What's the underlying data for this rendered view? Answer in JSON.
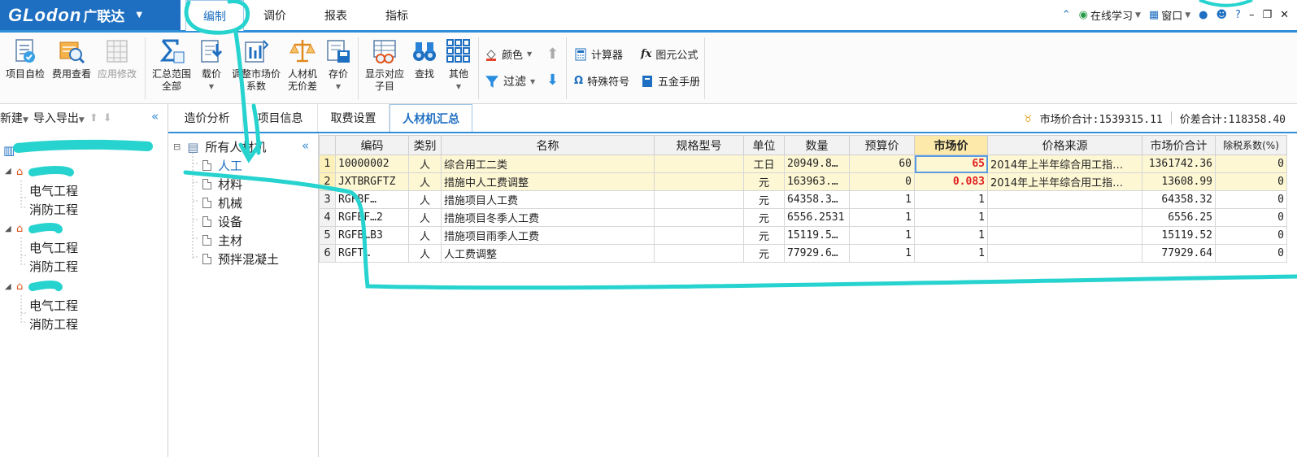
{
  "app": {
    "brand": "GLodon",
    "brand_cn": "广联达",
    "menu_tabs": [
      "编制",
      "调价",
      "报表",
      "指标"
    ],
    "active_menu_tab": "编制",
    "right_tools": {
      "online_learning": "在线学习",
      "window": "窗口",
      "help": "?"
    }
  },
  "ribbon": {
    "buttons": [
      {
        "label1": "项目自检",
        "label2": ""
      },
      {
        "label1": "费用查看",
        "label2": ""
      },
      {
        "label1": "应用修改",
        "label2": ""
      },
      {
        "label1": "汇总范围",
        "label2": "全部"
      },
      {
        "label1": "载价",
        "label2": ""
      },
      {
        "label1": "调整市场价",
        "label2": "系数"
      },
      {
        "label1": "人材机",
        "label2": "无价差"
      },
      {
        "label1": "存价",
        "label2": ""
      },
      {
        "label1": "显示对应",
        "label2": "子目"
      },
      {
        "label1": "查找",
        "label2": ""
      },
      {
        "label1": "其他",
        "label2": ""
      }
    ],
    "small": {
      "color": "颜色",
      "filter": "过滤",
      "calculator": "计算器",
      "formula": "图元公式",
      "special_symbol": "特殊符号",
      "hardware_manual": "五金手册"
    }
  },
  "left_panel": {
    "toolbar": {
      "new": "新建",
      "import_export": "导入导出"
    },
    "items": [
      "电气工程",
      "消防工程",
      "电气工程",
      "消防工程",
      "电气工程",
      "消防工程"
    ]
  },
  "content_tabs": {
    "tabs": [
      "造价分析",
      "项目信息",
      "取费设置",
      "人材机汇总"
    ],
    "active": "人材机汇总",
    "market_total": "市场价合计:1539315.11",
    "diff_total": "价差合计:118358.40"
  },
  "category_tree": {
    "root": "所有人材机",
    "items": [
      "人工",
      "材料",
      "机械",
      "设备",
      "主材",
      "预拌混凝土"
    ],
    "selected": "人工"
  },
  "grid": {
    "columns": [
      "",
      "编码",
      "类别",
      "名称",
      "规格型号",
      "单位",
      "数量",
      "预算价",
      "市场价",
      "价格来源",
      "市场价合计",
      "除税系数(%)"
    ],
    "rows": [
      {
        "n": "1",
        "code": "10000002",
        "type": "人",
        "name": "综合用工二类",
        "spec": "",
        "unit": "工日",
        "qty": "20949.8…",
        "budget": "60",
        "market": "65",
        "source": "2014年上半年综合用工指…",
        "total": "1361742.36",
        "tax": "0"
      },
      {
        "n": "2",
        "code": "JXTBRGFTZ",
        "type": "人",
        "name": "措施中人工费调整",
        "spec": "",
        "unit": "元",
        "qty": "163963.…",
        "budget": "0",
        "market": "0.083",
        "source": "2014年上半年综合用工指…",
        "total": "13608.99",
        "tax": "0"
      },
      {
        "n": "3",
        "code": "RGFBF…",
        "type": "人",
        "name": "措施项目人工费",
        "spec": "",
        "unit": "元",
        "qty": "64358.3…",
        "budget": "1",
        "market": "1",
        "source": "",
        "total": "64358.32",
        "tax": "0"
      },
      {
        "n": "4",
        "code": "RGFBF…2",
        "type": "人",
        "name": "措施项目冬季人工费",
        "spec": "",
        "unit": "元",
        "qty": "6556.2531",
        "budget": "1",
        "market": "1",
        "source": "",
        "total": "6556.25",
        "tax": "0"
      },
      {
        "n": "5",
        "code": "RGFB…B3",
        "type": "人",
        "name": "措施项目雨季人工费",
        "spec": "",
        "unit": "元",
        "qty": "15119.5…",
        "budget": "1",
        "market": "1",
        "source": "",
        "total": "15119.52",
        "tax": "0"
      },
      {
        "n": "6",
        "code": "RGFT…",
        "type": "人",
        "name": "人工费调整",
        "spec": "",
        "unit": "元",
        "qty": "77929.6…",
        "budget": "1",
        "market": "1",
        "source": "",
        "total": "77929.64",
        "tax": "0"
      }
    ]
  }
}
